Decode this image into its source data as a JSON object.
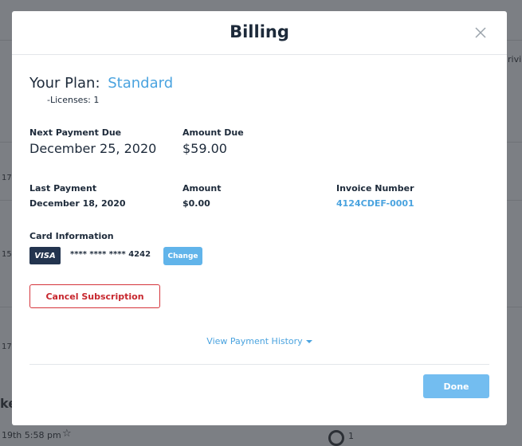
{
  "modal": {
    "title": "Billing",
    "plan_label": "Your Plan:",
    "plan_name": "Standard",
    "licenses": "-Licenses: 1",
    "next_payment_label": "Next Payment Due",
    "next_payment_value": "December 25, 2020",
    "amount_due_label": "Amount Due",
    "amount_due_value": "$59.00",
    "last_payment_label": "Last Payment",
    "last_payment_value": "December 18, 2020",
    "amount_label": "Amount",
    "amount_value": "$0.00",
    "invoice_label": "Invoice Number",
    "invoice_value": "4124CDEF-0001",
    "card_label": "Card Information",
    "card_brand": "VISA",
    "card_number": "**** **** **** 4242",
    "change_label": "Change",
    "cancel_label": "Cancel Subscription",
    "history_label": "View Payment History",
    "done_label": "Done"
  },
  "background": {
    "frag_right": "rivi",
    "frag_17a": "17",
    "frag_15": "15",
    "frag_17b": "17",
    "frag_ke": "ke",
    "frag_bottom": "19th 5:58 pm",
    "frag_count": "1"
  },
  "colors": {
    "accent": "#4aa3df",
    "danger": "#d5343b",
    "primary_button": "#73bdf0",
    "visa_bg": "#23344f"
  }
}
